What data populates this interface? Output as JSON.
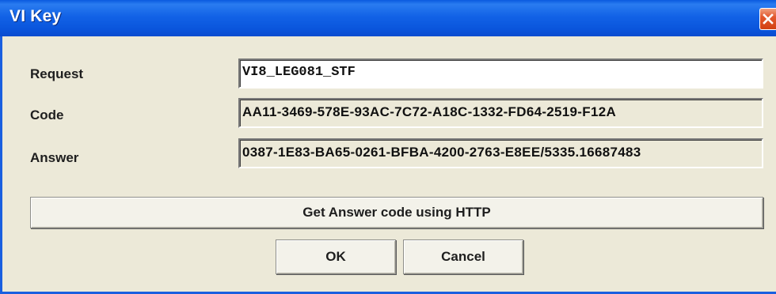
{
  "window": {
    "title": "VI Key",
    "close_icon": "close-icon"
  },
  "form": {
    "request": {
      "label": "Request",
      "value": "VI8_LEG081_STF"
    },
    "code": {
      "label": "Code",
      "value": "AA11-3469-578E-93AC-7C72-A18C-1332-FD64-2519-F12A"
    },
    "answer": {
      "label": "Answer",
      "value": "0387-1E83-BA65-0261-BFBA-4200-2763-E8EE/5335.16687483"
    }
  },
  "buttons": {
    "http_label": "Get Answer code using HTTP",
    "ok_label": "OK",
    "cancel_label": "Cancel"
  },
  "colors": {
    "titlebar": "#0a55dc",
    "dialog_bg": "#ece9d8",
    "close_button": "#e2582e"
  }
}
